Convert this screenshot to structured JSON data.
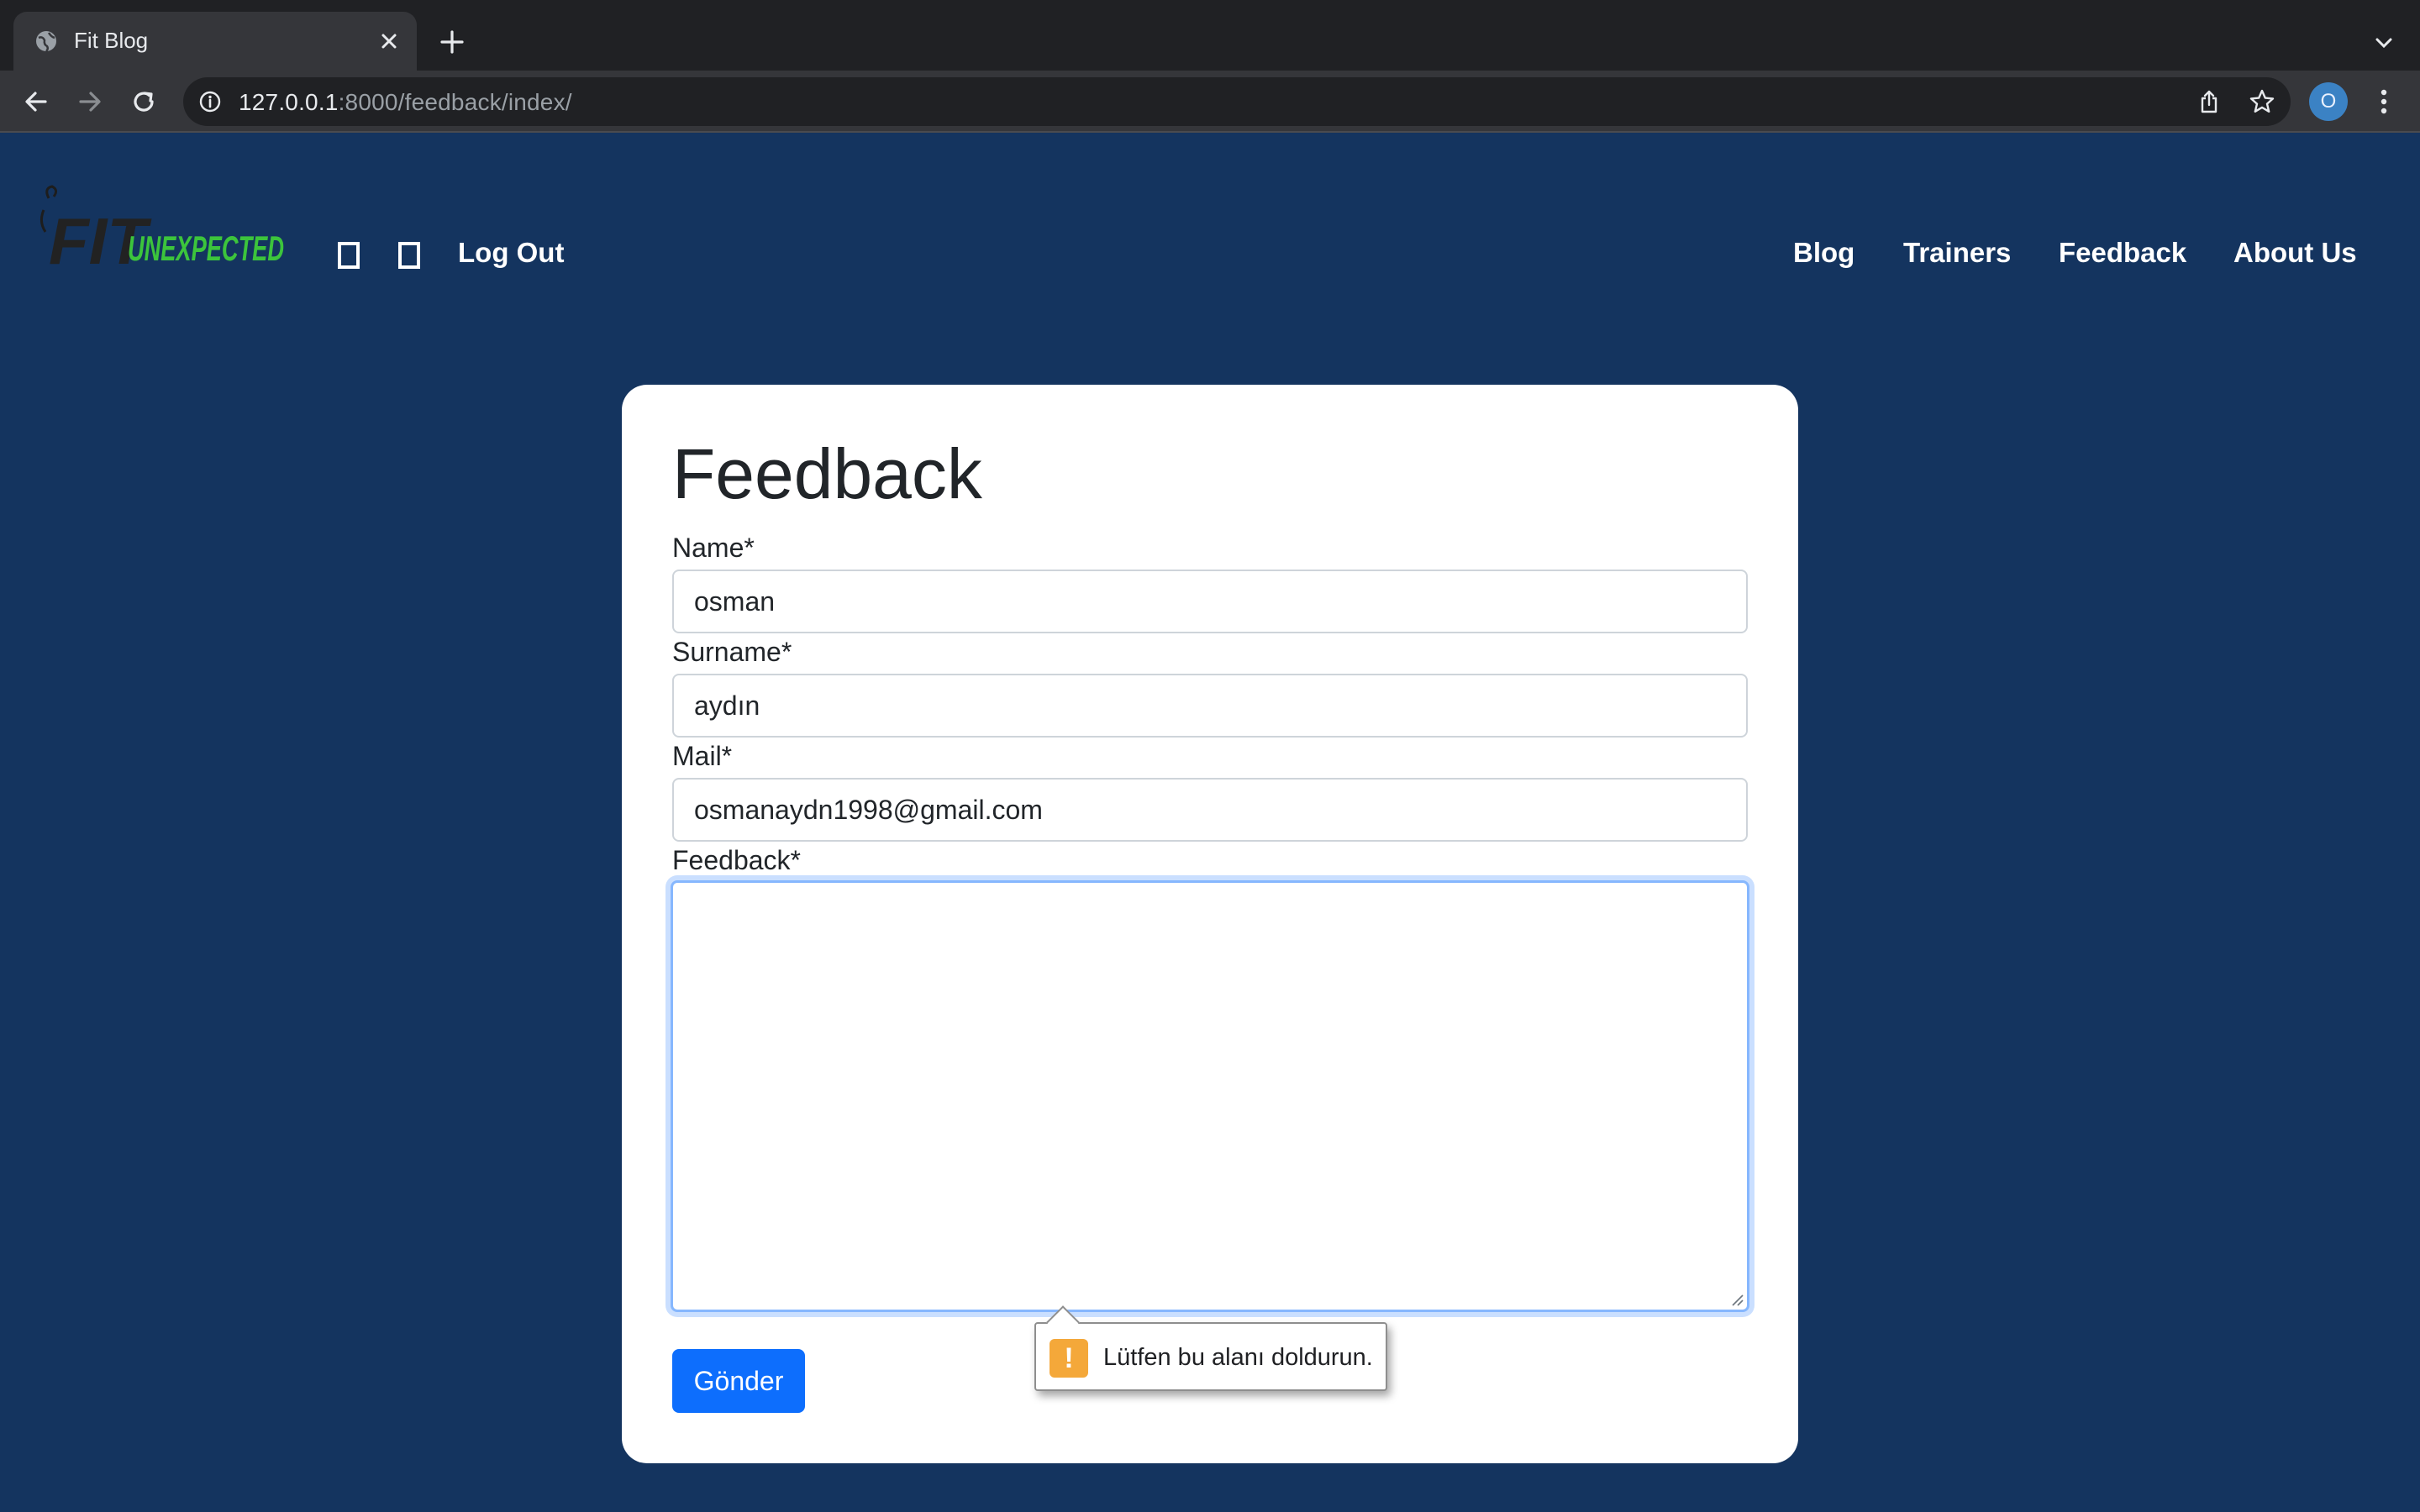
{
  "browser": {
    "tab_title": "Fit Blog",
    "url_host": "127.0.0.1",
    "url_rest": ":8000/feedback/index/",
    "profile_initial": "O"
  },
  "site": {
    "logo_icon": "fit-unexpected-logo",
    "logo_text_left": "FIT",
    "logo_text_right": "UNEXPECTED",
    "logout_label": "Log Out",
    "nav": {
      "blog": "Blog",
      "trainers": "Trainers",
      "feedback": "Feedback",
      "about": "About Us"
    }
  },
  "form": {
    "title": "Feedback",
    "name_label": "Name*",
    "name_value": "osman",
    "surname_label": "Surname*",
    "surname_value": "aydın",
    "mail_label": "Mail*",
    "mail_value": "osmanaydn1998@gmail.com",
    "feedback_label": "Feedback*",
    "feedback_value": "",
    "submit_label": "Gönder"
  },
  "validation": {
    "message": "Lütfen bu alanı doldurun.",
    "icon": "!"
  },
  "colors": {
    "page_bg": "#14345f",
    "primary": "#0d6efd",
    "logo_green": "#3cc43c",
    "warning": "#f4a83a"
  }
}
